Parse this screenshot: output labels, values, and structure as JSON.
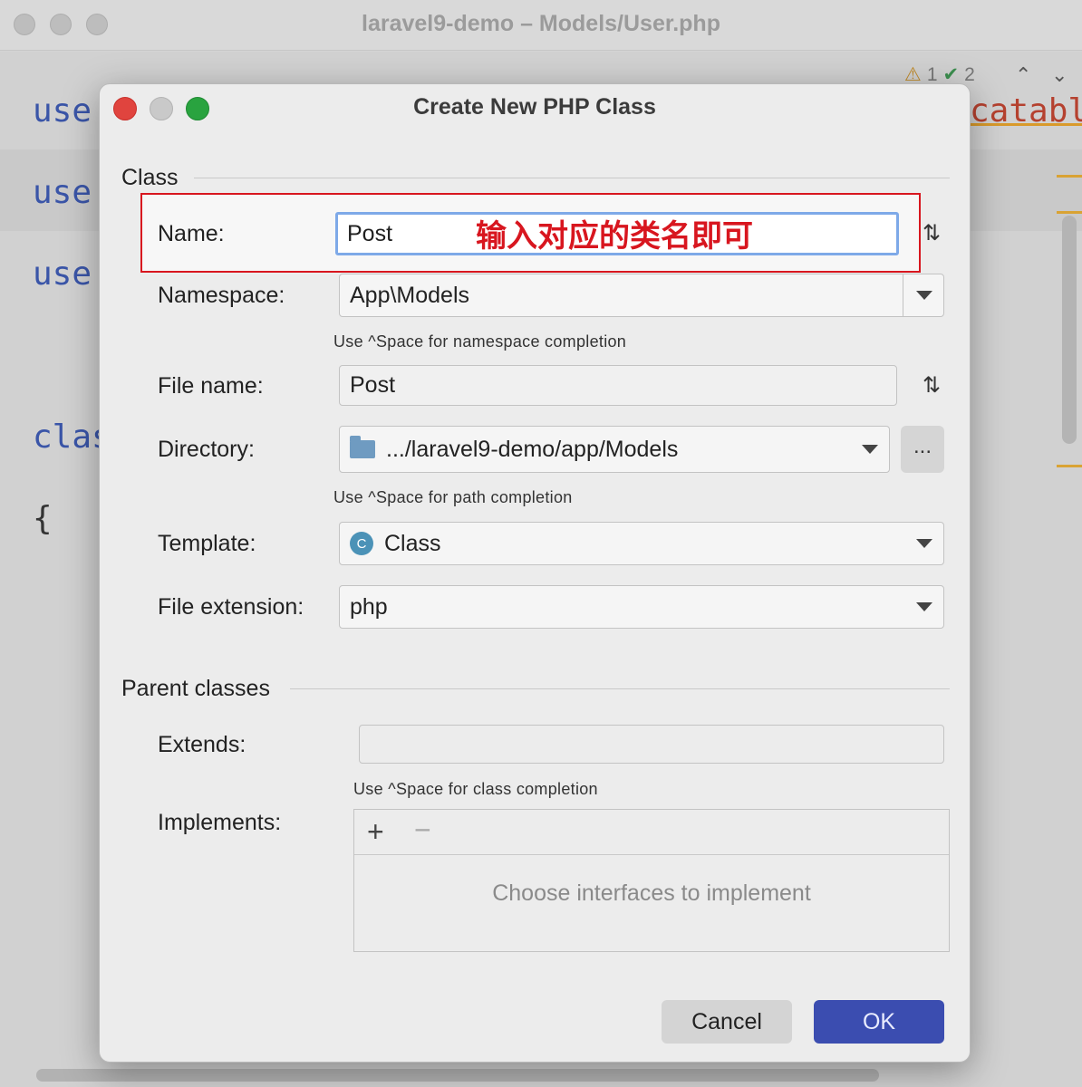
{
  "ide": {
    "title": "laravel9-demo – Models/User.php",
    "inspections": {
      "warnings": "1",
      "ok": "2"
    },
    "code_lines": [
      "use",
      "use",
      "use",
      "clas",
      "{"
    ],
    "code_tail": "catabl"
  },
  "dialog": {
    "title": "Create New PHP Class",
    "section_class": "Class",
    "name_label": "Name:",
    "name_value": "Post",
    "annotation": "输入对应的类名即可",
    "namespace_label": "Namespace:",
    "namespace_value": "App\\Models",
    "namespace_hint": "Use ^Space for namespace completion",
    "filename_label": "File name:",
    "filename_value": "Post",
    "directory_label": "Directory:",
    "directory_value": ".../laravel9-demo/app/Models",
    "browse_label": "...",
    "directory_hint": "Use ^Space for path completion",
    "template_label": "Template:",
    "template_icon_letter": "C",
    "template_value": "Class",
    "extension_label": "File extension:",
    "extension_value": "php",
    "section_parent": "Parent classes",
    "extends_label": "Extends:",
    "extends_value": "",
    "class_hint": "Use ^Space for class completion",
    "implements_label": "Implements:",
    "implements_add": "+",
    "implements_remove": "−",
    "implements_empty": "Choose interfaces to implement",
    "cancel_label": "Cancel",
    "ok_label": "OK"
  },
  "colors": {
    "annotation": "#d8161f",
    "ok_button": "#3b4db0",
    "focus_ring": "#7ea9e8"
  }
}
